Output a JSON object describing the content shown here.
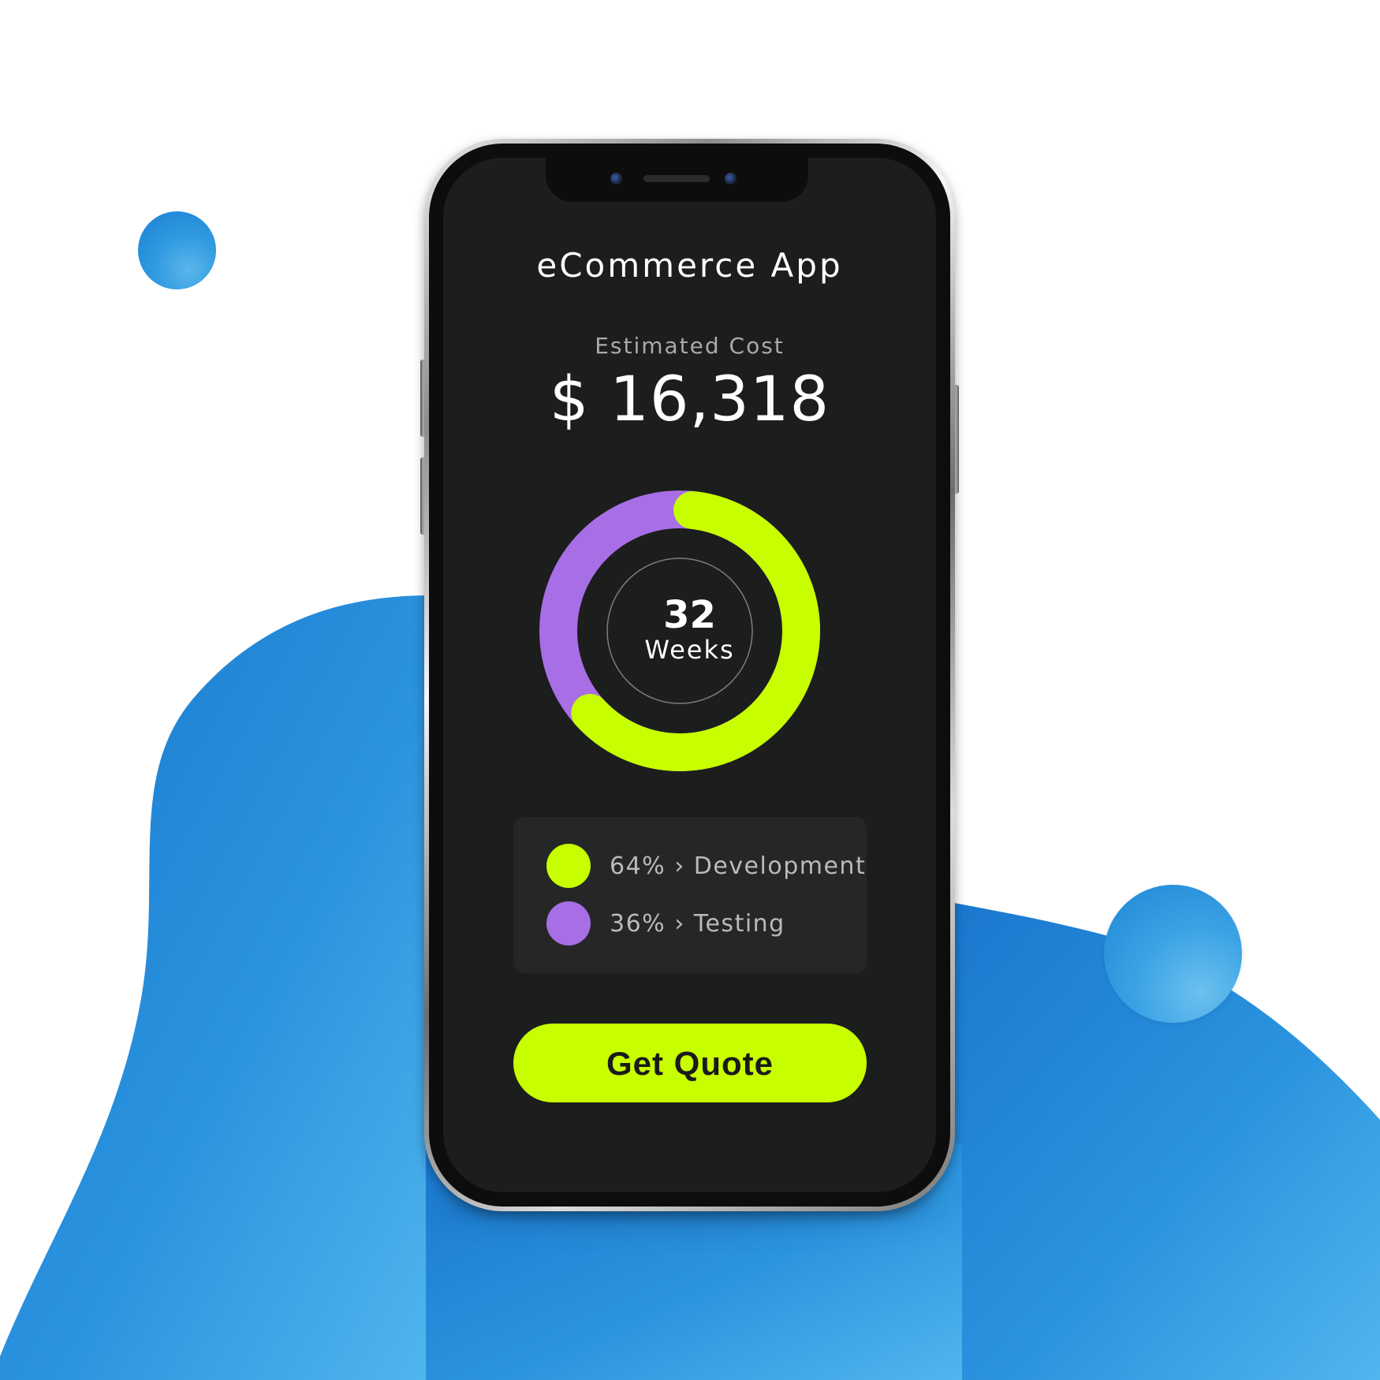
{
  "app_title": "eCommerce App",
  "estimate": {
    "label": "Estimated Cost",
    "value": "$ 16,318"
  },
  "timeline": {
    "number": "32",
    "unit": "Weeks"
  },
  "chart_data": {
    "type": "pie",
    "categories": [
      "Development",
      "Testing"
    ],
    "values": [
      64,
      36
    ],
    "unit": "%",
    "colors": [
      "#c8ff00",
      "#a86ee6"
    ]
  },
  "legend": [
    {
      "text": "64% › Development",
      "color": "#c8ff00"
    },
    {
      "text": "36% › Testing",
      "color": "#a86ee6"
    }
  ],
  "cta": {
    "label": "Get Quote"
  },
  "colors": {
    "accent": "#c8ff00",
    "secondary": "#a86ee6",
    "screen_bg": "#1c1d1d",
    "backdrop_blue": "#2a8fdc"
  }
}
